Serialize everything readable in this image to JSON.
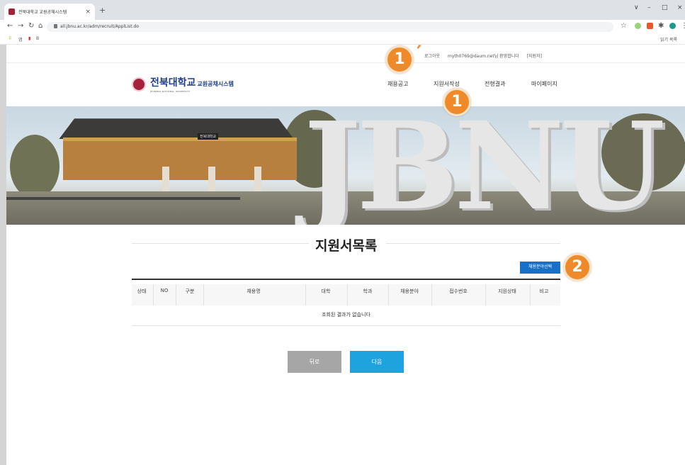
{
  "browser": {
    "tab_title": "전북대학교 교원공채시스템",
    "tab_close": "×",
    "new_tab": "+",
    "url": "all.jbnu.ac.kr/adm/recruit/ApplList.do",
    "window_controls": [
      "∨",
      "–",
      "□",
      "×"
    ],
    "bookmarks": [
      "앱",
      "▮",
      "B"
    ],
    "bookmark_right": "읽기 목록"
  },
  "topbar": {
    "logout": "로그아웃",
    "welcome": "myth0769@daum.net님 환영합니다",
    "applicant": "[지원자]"
  },
  "header": {
    "logo_main": "전북대학교",
    "logo_sub": "교원공채시스템",
    "logo_en": "JEONBUK NATIONAL UNIVERSITY",
    "nav": [
      {
        "label": "채용공고"
      },
      {
        "label": "지원서작성"
      },
      {
        "label": "전형결과"
      },
      {
        "label": "마이페이지"
      }
    ]
  },
  "banner": {
    "sign": "JBNU",
    "gate_plaque": "전북대학교"
  },
  "main": {
    "title": "지원서목록",
    "select_button": "채용분야선택",
    "table": {
      "columns": [
        "상태",
        "NO",
        "구분",
        "채용명",
        "대학",
        "학과",
        "채용분야",
        "접수번호",
        "지원상태",
        "비고"
      ],
      "empty_message": "조회된 결과가 없습니다"
    },
    "prev_button": "뒤로",
    "next_button": "다음"
  },
  "annotations": {
    "marker1_prime": "1",
    "prime": "′",
    "marker1": "1",
    "marker2": "2",
    "color": "#ee8a2a"
  },
  "colors": {
    "brand": "#1e3d8a",
    "select_button": "#1a70c7",
    "next_button": "#1fa3de",
    "prev_button": "#a6a6a6"
  }
}
